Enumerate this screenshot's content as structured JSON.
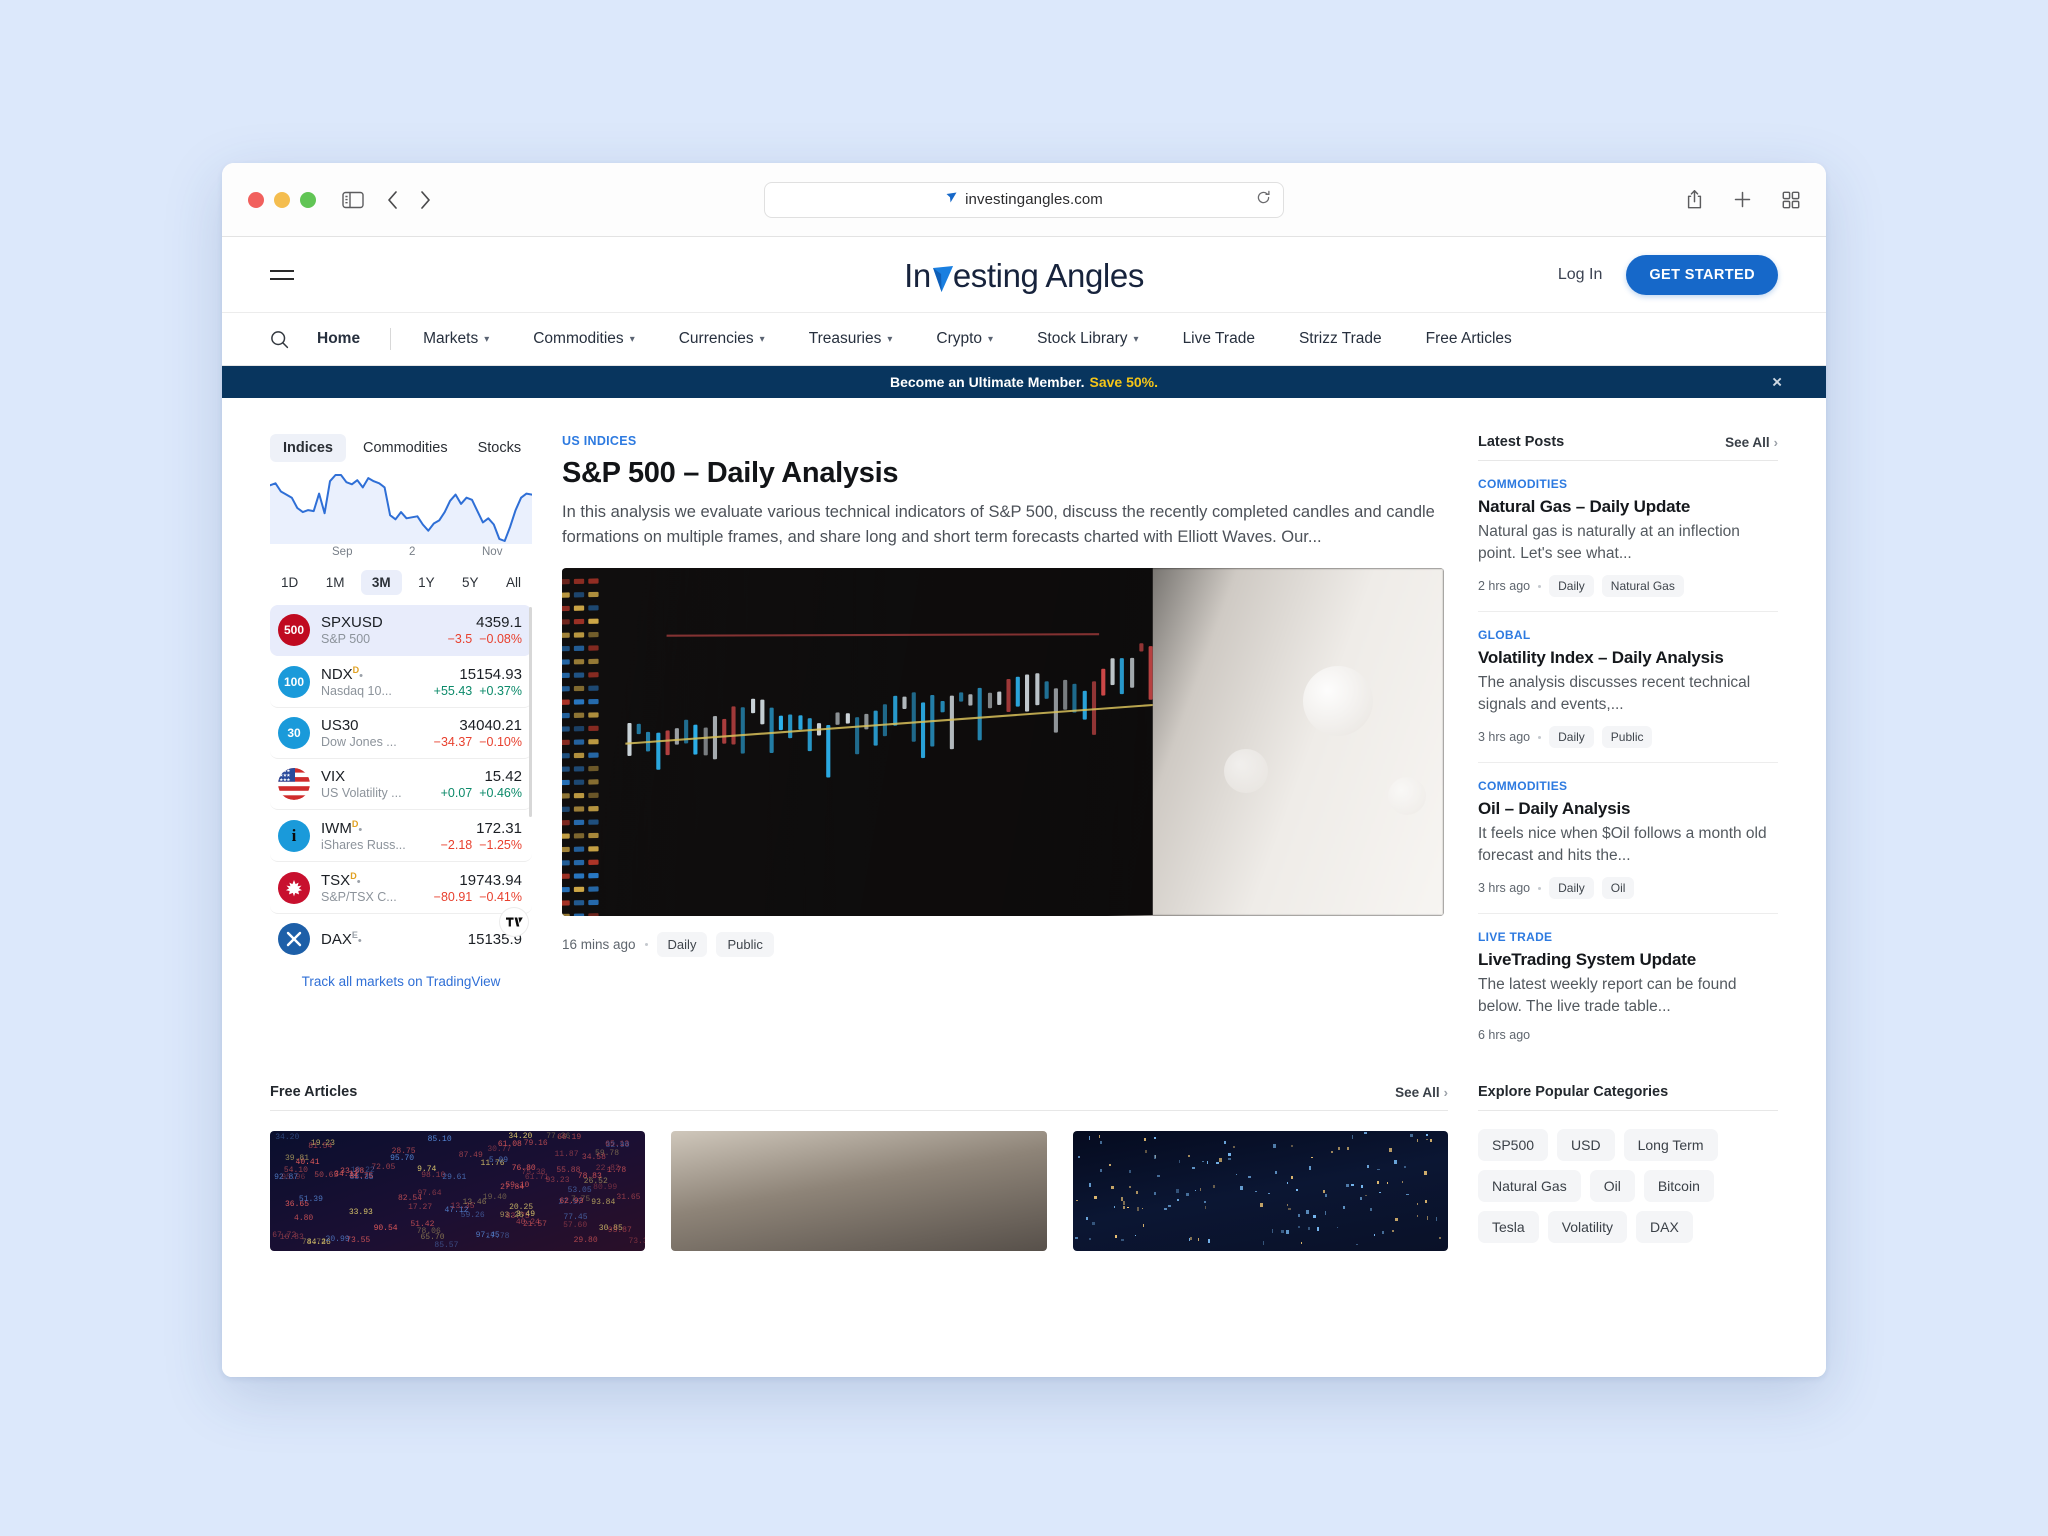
{
  "browser": {
    "url": "investingangles.com",
    "icons": {
      "sidebar": "sidebar-toggle-icon",
      "back": "back-arrow-icon",
      "forward": "forward-arrow-icon",
      "reload": "reload-icon",
      "share": "share-icon",
      "new_tab": "plus-icon",
      "tab_overview": "tab-grid-icon",
      "site": "site-badge-icon"
    }
  },
  "header": {
    "logo_pre": "In",
    "logo_mid": "V",
    "logo_post": "esting Angles",
    "login_label": "Log In",
    "cta_label": "GET STARTED"
  },
  "nav": {
    "home": "Home",
    "items": [
      {
        "label": "Markets",
        "caret": true
      },
      {
        "label": "Commodities",
        "caret": true
      },
      {
        "label": "Currencies",
        "caret": true
      },
      {
        "label": "Treasuries",
        "caret": true
      },
      {
        "label": "Crypto",
        "caret": true
      },
      {
        "label": "Stock Library",
        "caret": true
      },
      {
        "label": "Live Trade",
        "caret": false
      },
      {
        "label": "Strizz Trade",
        "caret": false
      },
      {
        "label": "Free Articles",
        "caret": false
      }
    ]
  },
  "promo": {
    "text": "Become an Ultimate Member.",
    "highlight": "Save 50%.",
    "close": "×"
  },
  "widget": {
    "tabs": [
      {
        "label": "Indices",
        "active": true
      },
      {
        "label": "Commodities",
        "active": false
      },
      {
        "label": "Stocks",
        "active": false
      }
    ],
    "axis_labels": [
      "Sep",
      "2",
      "Nov"
    ],
    "ranges": [
      {
        "label": "1D",
        "active": false
      },
      {
        "label": "1M",
        "active": false
      },
      {
        "label": "3M",
        "active": true
      },
      {
        "label": "1Y",
        "active": false
      },
      {
        "label": "5Y",
        "active": false
      },
      {
        "label": "All",
        "active": false
      }
    ],
    "tickers": [
      {
        "badge": "500",
        "badge_style": "red",
        "symbol": "SPXUSD",
        "sup": "",
        "name": "S&P 500",
        "price": "4359.1",
        "change": "−3.5",
        "percent": "−0.08%",
        "dir": "down",
        "active": true
      },
      {
        "badge": "100",
        "badge_style": "blue",
        "symbol": "NDX",
        "sup": "D",
        "name": "Nasdaq 10...",
        "price": "15154.93",
        "change": "+55.43",
        "percent": "+0.37%",
        "dir": "up",
        "active": false
      },
      {
        "badge": "30",
        "badge_style": "blue",
        "symbol": "US30",
        "sup": "",
        "name": "Dow Jones ...",
        "price": "34040.21",
        "change": "−34.37",
        "percent": "−0.10%",
        "dir": "down",
        "active": false
      },
      {
        "badge": "flag",
        "badge_style": "flag",
        "symbol": "VIX",
        "sup": "",
        "name": "US Volatility ...",
        "price": "15.42",
        "change": "+0.07",
        "percent": "+0.46%",
        "dir": "up",
        "active": false
      },
      {
        "badge": "i",
        "badge_style": "blue",
        "symbol": "IWM",
        "sup": "D",
        "name": "iShares Russ...",
        "price": "172.31",
        "change": "−2.18",
        "percent": "−1.25%",
        "dir": "down",
        "active": false
      },
      {
        "badge": "maple",
        "badge_style": "maple",
        "symbol": "TSX",
        "sup": "D",
        "name": "S&P/TSX C...",
        "price": "19743.94",
        "change": "−80.91",
        "percent": "−0.41%",
        "dir": "down",
        "active": false
      },
      {
        "badge": "dax",
        "badge_style": "dax",
        "symbol": "DAX",
        "sup": "E",
        "name": "",
        "price": "15135.9",
        "change": "",
        "percent": "",
        "dir": "down",
        "active": false
      }
    ],
    "tv_link": "Track all markets on TradingView",
    "tv_logo": "tradingview-logo-icon"
  },
  "article": {
    "eyebrow": "US INDICES",
    "title": "S&P 500 – Daily Analysis",
    "excerpt": "In this analysis we evaluate various technical indicators of S&P 500, discuss the recently completed candles and candle formations on multiple frames, and share long and short term forecasts charted with Elliott Waves. Our...",
    "time": "16 mins ago",
    "tags": [
      "Daily",
      "Public"
    ]
  },
  "latest": {
    "title": "Latest Posts",
    "see_all": "See All",
    "posts": [
      {
        "category": "COMMODITIES",
        "title": "Natural Gas – Daily Update",
        "excerpt": "Natural gas is naturally at an inflection point. Let's see what...",
        "time": "2 hrs ago",
        "tags": [
          "Daily",
          "Natural Gas"
        ]
      },
      {
        "category": "GLOBAL",
        "title": "Volatility Index – Daily Analysis",
        "excerpt": "The analysis discusses recent technical signals and events,...",
        "time": "3 hrs ago",
        "tags": [
          "Daily",
          "Public"
        ]
      },
      {
        "category": "COMMODITIES",
        "title": "Oil – Daily Analysis",
        "excerpt": "It feels nice when $Oil follows a month old forecast and hits the...",
        "time": "3 hrs ago",
        "tags": [
          "Daily",
          "Oil"
        ]
      },
      {
        "category": "LIVE TRADE",
        "title": "LiveTrading System Update",
        "excerpt": "The latest weekly report can be found below. The live trade table...",
        "time": "6 hrs ago",
        "tags": []
      }
    ]
  },
  "free_articles": {
    "title": "Free Articles",
    "see_all": "See All"
  },
  "categories": {
    "title": "Explore Popular Categories",
    "tags": [
      "SP500",
      "USD",
      "Long Term",
      "Natural Gas",
      "Oil",
      "Bitcoin",
      "Tesla",
      "Volatility",
      "DAX"
    ]
  },
  "chart_data": {
    "type": "line",
    "title": "Indices sparkline",
    "xlabel": "",
    "ylabel": "",
    "x_ticks": [
      "Sep",
      "2",
      "Nov"
    ],
    "series": [
      {
        "name": "Indices",
        "values": [
          70,
          72,
          64,
          61,
          58,
          48,
          44,
          46,
          45,
          62,
          43,
          74,
          80,
          80,
          73,
          71,
          75,
          68,
          77,
          74,
          72,
          68,
          41,
          37,
          44,
          38,
          39,
          40,
          32,
          26,
          33,
          36,
          44,
          55,
          61,
          52,
          58,
          56,
          45,
          34,
          38,
          32,
          18,
          16,
          30,
          46,
          58,
          62,
          61
        ]
      }
    ],
    "color": "#2f6fd6",
    "fill": "#eaf0fd",
    "grid": false,
    "legend": false
  }
}
